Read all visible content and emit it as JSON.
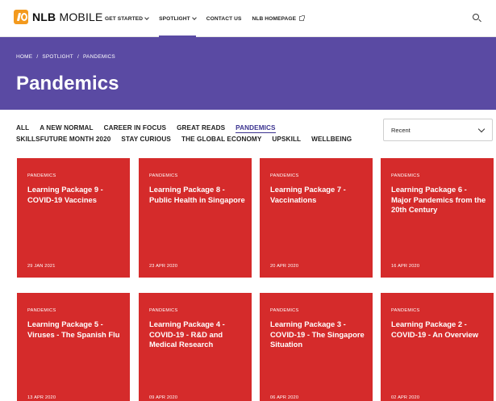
{
  "brand": {
    "bold": "NLB",
    "rest": " MOBILE"
  },
  "nav": {
    "items": [
      {
        "label": "GET STARTED"
      },
      {
        "label": "SPOTLIGHT"
      },
      {
        "label": "CONTACT US"
      },
      {
        "label": "NLB HOMEPAGE"
      }
    ]
  },
  "breadcrumb": {
    "home": "HOME",
    "spotlight": "SPOTLIGHT",
    "current": "PANDEMICS",
    "separator": "/"
  },
  "page": {
    "title": "Pandemics"
  },
  "filters": {
    "row1": [
      "ALL",
      "A NEW NORMAL",
      "CAREER IN FOCUS",
      "GREAT READS",
      "PANDEMICS"
    ],
    "row2": [
      "SKILLSFUTURE MONTH 2020",
      "STAY CURIOUS",
      "THE GLOBAL ECONOMY",
      "UPSKILL",
      "WELLBEING"
    ],
    "active": "PANDEMICS"
  },
  "sort": {
    "selected": "Recent"
  },
  "cards": [
    {
      "category": "PANDEMICS",
      "title": "Learning Package 9 - COVID-19 Vaccines",
      "date": "29 JAN 2021"
    },
    {
      "category": "PANDEMICS",
      "title": "Learning Package 8 - Public Health in Singapore",
      "date": "23 APR 2020"
    },
    {
      "category": "PANDEMICS",
      "title": "Learning Package 7 - Vaccinations",
      "date": "20 APR 2020"
    },
    {
      "category": "PANDEMICS",
      "title": "Learning Package 6 - Major Pandemics from the 20th Century",
      "date": "16 APR 2020"
    },
    {
      "category": "PANDEMICS",
      "title": "Learning Package 5 - Viruses - The Spanish Flu",
      "date": "13 APR 2020"
    },
    {
      "category": "PANDEMICS",
      "title": "Learning Package 4 - COVID-19 - R&D and Medical Research",
      "date": "09 APR 2020"
    },
    {
      "category": "PANDEMICS",
      "title": "Learning Package 3 - COVID-19 - The Singapore Situation",
      "date": "06 APR 2020"
    },
    {
      "category": "PANDEMICS",
      "title": "Learning Package 2 - COVID-19 - An Overview",
      "date": "02 APR 2020"
    }
  ],
  "colors": {
    "hero": "#5a4aa3",
    "card": "#d52b2b",
    "active_filter": "#3c3490",
    "logo": "#f39a1e"
  },
  "icons": {
    "logo": "nlb-logo-icon",
    "search": "search-icon",
    "external": "external-link-icon",
    "chevron": "chevron-down-icon"
  }
}
